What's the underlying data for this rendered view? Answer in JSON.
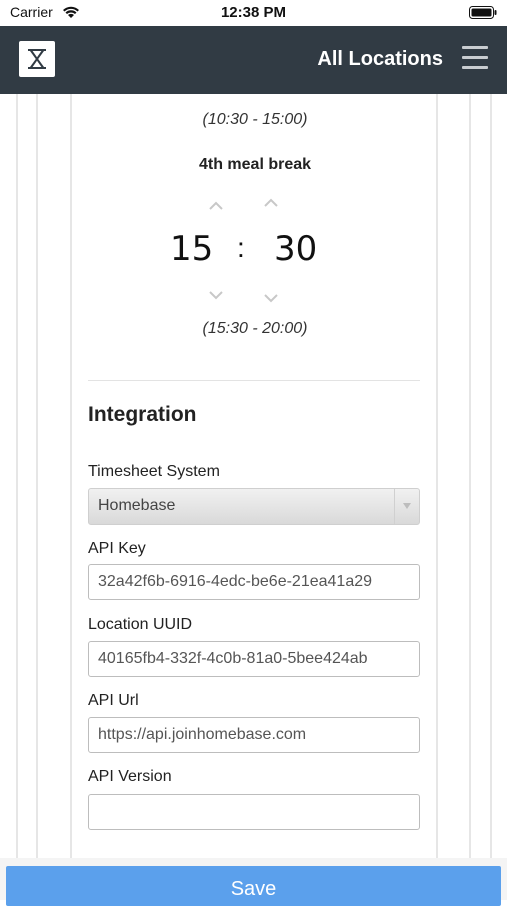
{
  "status": {
    "carrier": "Carrier",
    "time": "12:38 PM"
  },
  "nav": {
    "title": "All Locations"
  },
  "breaks": {
    "prev_range": "(10:30 - 15:00)",
    "label": "4th meal break",
    "hours": "15",
    "separator": ":",
    "minutes": "30",
    "range": "(15:30 - 20:00)"
  },
  "integration": {
    "title": "Integration",
    "timesheet_label": "Timesheet System",
    "timesheet_value": "Homebase",
    "api_key_label": "API Key",
    "api_key_value": "32a42f6b-6916-4edc-be6e-21ea41a29",
    "location_uuid_label": "Location UUID",
    "location_uuid_value": "40165fb4-332f-4c0b-81a0-5bee424ab",
    "api_url_label": "API Url",
    "api_url_value": "https://api.joinhomebase.com",
    "api_version_label": "API Version",
    "api_version_value": ""
  },
  "actions": {
    "save_label": "Save"
  },
  "colors": {
    "navbar": "#313b44",
    "save_button": "#5ba0ec"
  }
}
